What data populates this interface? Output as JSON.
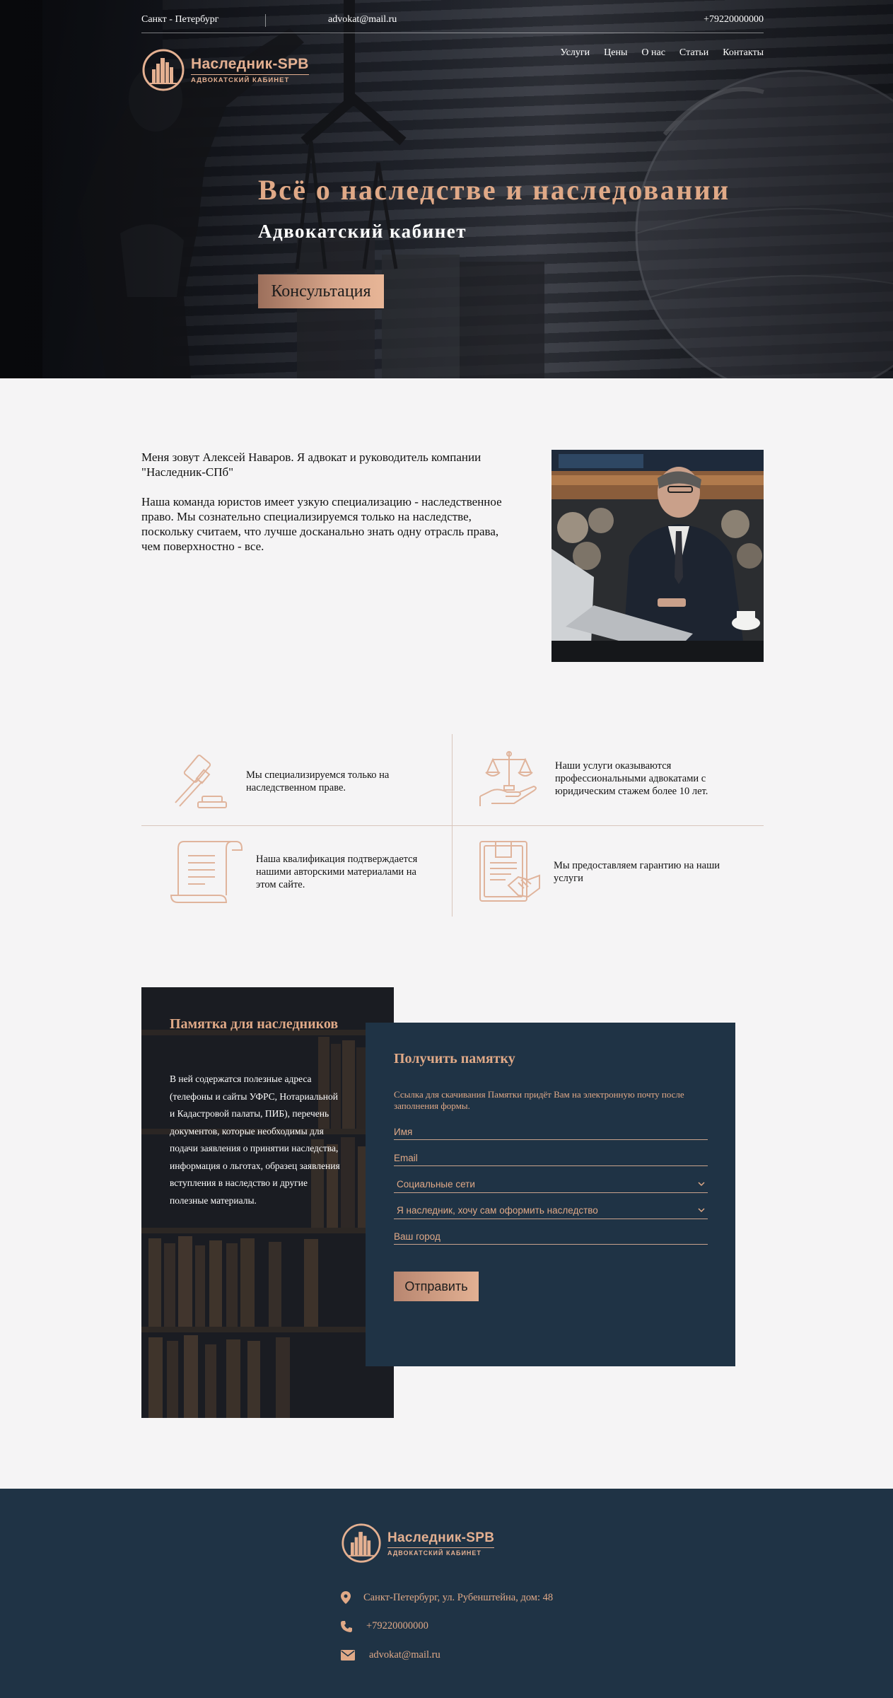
{
  "colors": {
    "accent": "#e0a987",
    "navy": "#1f3345",
    "page_bg": "#f5f4f5"
  },
  "topbar": {
    "city": "Санкт - Петербург",
    "email": "advokat@mail.ru",
    "phone": "+79220000000"
  },
  "logo": {
    "name": "Наследник-SPB",
    "subtitle": "АДВОКАТСКИЙ КАБИНЕТ"
  },
  "nav": {
    "items": [
      "Услуги",
      "Цены",
      "О нас",
      "Статьи",
      "Контакты"
    ]
  },
  "hero": {
    "title": "Всё о наследстве и наследовании",
    "subtitle": "Адвокатский кабинет",
    "cta": "Консультация"
  },
  "about": {
    "paragraph1": "Меня зовут Алексей Наваров. Я адвокат и руководитель компании \"Наследник-СПб\"",
    "paragraph2": "Наша команда юристов имеет узкую специализацию - наследственное право. Мы сознательно специализируемся только на наследстве, поскольку считаем, что лучше досканально знать одну отрасль права, чем поверхностно - все."
  },
  "features": [
    {
      "icon": "gavel-icon",
      "text": "Мы специализируемся только на наследственном праве."
    },
    {
      "icon": "scales-hand-icon",
      "text": "Наши услуги оказываются профессиональными адвокатами с юридическим стажем более 10 лет."
    },
    {
      "icon": "scroll-icon",
      "text": "Наша квалификация подтверждается нашими авторскими материалами на этом сайте."
    },
    {
      "icon": "contract-handshake-icon",
      "text": "Мы предоставляем гарантию на наши услуги"
    }
  ],
  "memo": {
    "title": "Памятка для наследников",
    "text": "В ней содержатся полезные адреса (телефоны и сайты УФРС, Нотариальной и Кадастровой палаты, ПИБ), перечень документов, которые необходимы для подачи заявления о принятии наследства, информация о льготах, образец заявления вступления в наследство и другие полезные материалы."
  },
  "form": {
    "title": "Получить памятку",
    "hint": "Ссылка для скачивания Памятки придёт Вам на электронную почту после заполнения формы.",
    "name_placeholder": "Имя",
    "email_placeholder": "Email",
    "social_select": "Социальные сети",
    "role_select": "Я наследник, хочу сам оформить наследство",
    "city_placeholder": "Ваш город",
    "submit": "Отправить"
  },
  "footer": {
    "address": "Санкт-Петербург, ул. Рубенштейна, дом: 48",
    "phone": "+79220000000",
    "email": "advokat@mail.ru"
  }
}
